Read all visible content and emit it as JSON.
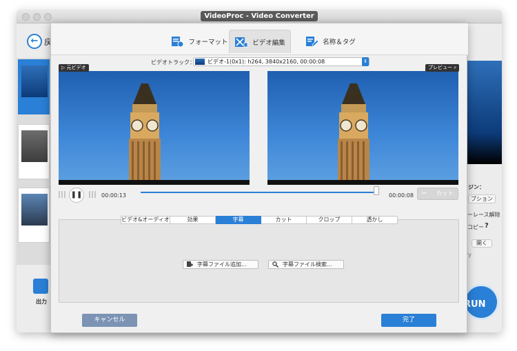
{
  "window": {
    "title": "VideoProc - Video Converter",
    "back_label": "戻",
    "output_label": "出力",
    "right_labels": {
      "option_heading": "ジン：",
      "option_button": "プション",
      "interlace": "ーレース解除",
      "copy": "コピー",
      "help": "?",
      "open_button": "開く",
      "folder_hint": "ry"
    },
    "run_label": "RUN"
  },
  "dialog": {
    "tabs": [
      {
        "label": "フォーマット",
        "icon": "format-icon"
      },
      {
        "label": "ビデオ編集",
        "icon": "video-edit-icon"
      },
      {
        "label": "名称＆タグ",
        "icon": "name-tag-icon"
      }
    ],
    "active_tab": "ビデオ編集",
    "video_track_label": "ビデオトラック：",
    "video_track_value": "ビデオ-1(0x1): h264, 3840x2160, 00:00:08",
    "original_tag": "▷ 元ビデオ",
    "preview_tag": "プレビュー",
    "time_current": "00:00:13",
    "time_total": "00:00:08",
    "cut_label": "カット",
    "progress_fraction": 1.0,
    "sub_tabs": [
      "ビデオ&オーディオ",
      "効果",
      "字幕",
      "カット",
      "クロップ",
      "透かし"
    ],
    "active_sub_tab": "字幕",
    "add_subtitle": "字幕ファイル追加...",
    "search_subtitle": "字幕ファイル検索...",
    "cancel": "キャンセル",
    "done": "完了"
  },
  "colors": {
    "accent": "#2a7fd6",
    "cancel": "#7c93b4",
    "sky": "#3e87d8"
  }
}
